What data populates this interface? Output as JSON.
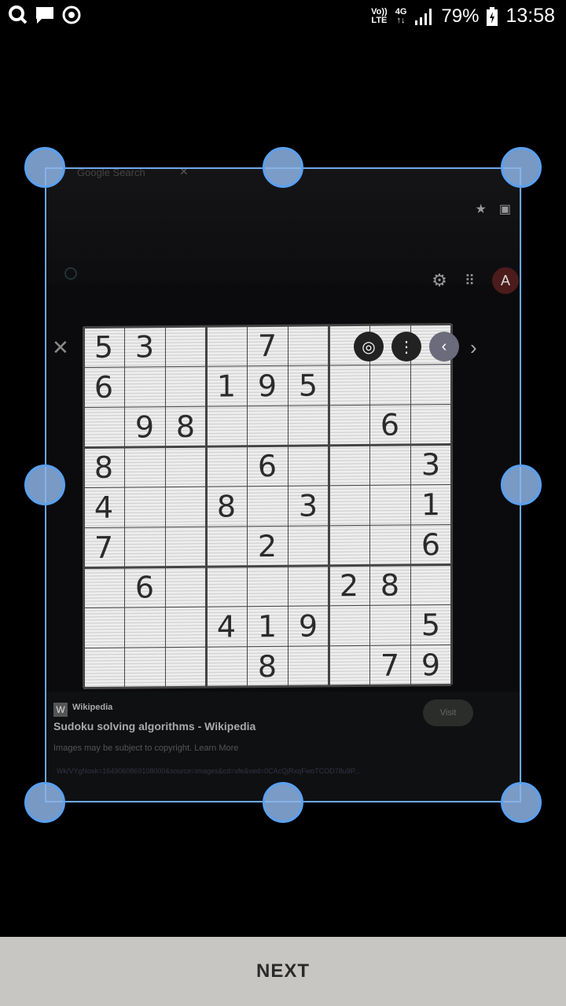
{
  "status_bar": {
    "volte_top": "Vo))",
    "volte_bottom": "LTE",
    "network_top": "4G",
    "network_bottom": "↑↓",
    "battery": "79%",
    "time": "13:58"
  },
  "photo": {
    "tab_text": "Google Search",
    "avatar_letter": "A",
    "sudoku_digits": [
      [
        "5",
        "3",
        "",
        "",
        "7",
        "",
        "",
        "",
        ""
      ],
      [
        "6",
        "",
        "",
        "1",
        "9",
        "5",
        "",
        "",
        ""
      ],
      [
        "",
        "9",
        "8",
        "",
        "",
        "",
        "",
        "6",
        ""
      ],
      [
        "8",
        "",
        "",
        "",
        "6",
        "",
        "",
        "",
        "3"
      ],
      [
        "4",
        "",
        "",
        "8",
        "",
        "3",
        "",
        "",
        "1"
      ],
      [
        "7",
        "",
        "",
        "",
        "2",
        "",
        "",
        "",
        "6"
      ],
      [
        "",
        "6",
        "",
        "",
        "",
        "",
        "2",
        "8",
        ""
      ],
      [
        "",
        "",
        "",
        "4",
        "1",
        "9",
        "",
        "",
        "5"
      ],
      [
        "",
        "",
        "",
        "",
        "8",
        "",
        "",
        "7",
        "9"
      ]
    ],
    "source_name": "Wikipedia",
    "result_title": "Sudoku solving algorithms - Wikipedia",
    "copyright_note": "Images may be subject to copyright. Learn More",
    "visit_label": "Visit",
    "url_text": "Wk/VYgNoxk=1649060869108000&source=images&cd=vfe&ved=0CAcQjRxqFwoTCOD78u9P..."
  },
  "bottom_bar": {
    "next_label": "NEXT"
  }
}
